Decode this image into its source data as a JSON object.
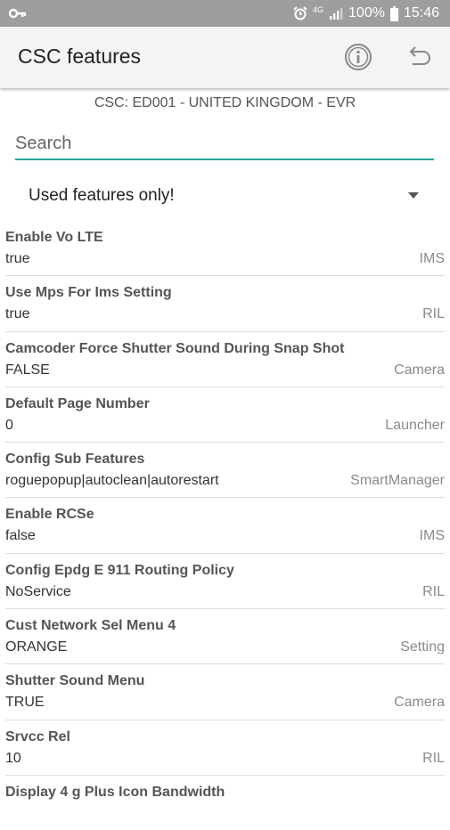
{
  "status_bar": {
    "network": "4G",
    "battery": "100%",
    "time": "15:46"
  },
  "app_bar": {
    "title": "CSC features",
    "info_icon": "info-icon",
    "back_icon": "undo-icon"
  },
  "csc_line": "CSC: ED001 - UNITED KINGDOM - EVR",
  "search": {
    "placeholder": "Search",
    "value": ""
  },
  "filter": {
    "selected": "Used features only!"
  },
  "features": [
    {
      "name": "Enable Vo LTE",
      "value": "true",
      "category": "IMS"
    },
    {
      "name": "Use Mps For Ims Setting",
      "value": "true",
      "category": "RIL"
    },
    {
      "name": "Camcoder Force Shutter Sound During Snap Shot",
      "value": "FALSE",
      "category": "Camera"
    },
    {
      "name": "Default Page Number",
      "value": "0",
      "category": "Launcher"
    },
    {
      "name": "Config Sub Features",
      "value": "roguepopup|autoclean|autorestart",
      "category": "SmartManager"
    },
    {
      "name": "Enable RCSe",
      "value": "false",
      "category": "IMS"
    },
    {
      "name": "Config Epdg E 911 Routing Policy",
      "value": "NoService",
      "category": "RIL"
    },
    {
      "name": "Cust Network Sel Menu 4",
      "value": "ORANGE",
      "category": "Setting"
    },
    {
      "name": "Shutter Sound Menu",
      "value": "TRUE",
      "category": "Camera"
    },
    {
      "name": "Srvcc Rel",
      "value": "10",
      "category": "RIL"
    },
    {
      "name": "Display 4 g Plus Icon Bandwidth",
      "value": "",
      "category": ""
    }
  ],
  "colors": {
    "accent": "#26a69a",
    "status_bar": "#9e9e9e",
    "app_bar": "#f4f4f4"
  }
}
